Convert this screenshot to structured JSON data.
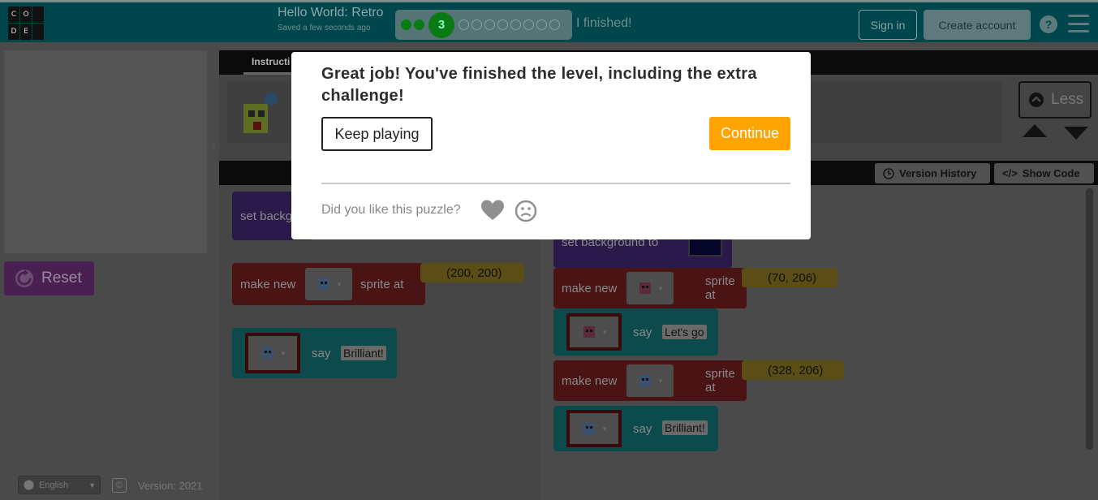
{
  "header": {
    "logo_letters": [
      "C",
      "O",
      "",
      "D",
      "E",
      ""
    ],
    "project_title": "Hello World: Retro",
    "saved_status": "Saved a few seconds ago",
    "current_level": "3",
    "finished_label": "I finished!",
    "sign_in_label": "Sign in",
    "create_account_label": "Create account",
    "help_label": "?"
  },
  "stage": {
    "reset_label": "Reset"
  },
  "footer": {
    "language": "English",
    "copyright_symbol": "©",
    "version": "Version: 2021"
  },
  "instructions": {
    "tab_label": "Instructi",
    "less_label": "Less"
  },
  "workspace": {
    "version_history_label": "Version History",
    "show_code_label": "Show Code"
  },
  "toolbox_blocks": {
    "set_background": "set backg",
    "make_new": "make new",
    "sprite_at": "sprite at",
    "coords": "(200, 200)",
    "say": "say",
    "say_value": "Brilliant!"
  },
  "workspace_blocks": {
    "set_background": "set background to",
    "make_new_1": "make new",
    "sprite_at_1": "sprite at",
    "coords_1": "(70, 206)",
    "say_1": "say",
    "say_value_1": "Let's go",
    "make_new_2": "make new",
    "sprite_at_2": "sprite at",
    "coords_2": "(328, 206)",
    "say_2": "say",
    "say_value_2": "Brilliant!"
  },
  "modal": {
    "title": "Great job! You've finished the level, including the extra challenge!",
    "keep_playing_label": "Keep playing",
    "continue_label": "Continue",
    "feedback_question": "Did you like this puzzle?"
  },
  "colors": {
    "header_bg": "#00474d",
    "continue_bg": "#ffa400",
    "progress_done": "#0a7a14"
  }
}
